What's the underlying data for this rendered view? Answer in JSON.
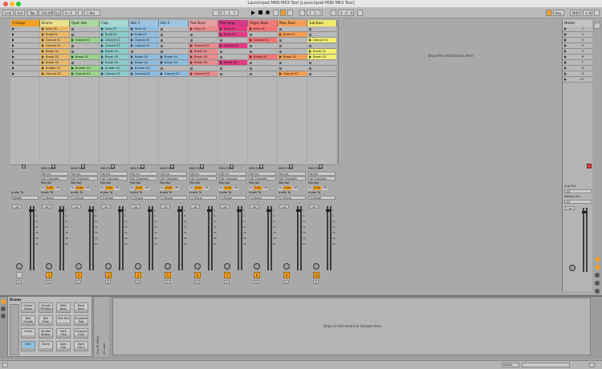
{
  "window": {
    "title": "Launchpad MINI MK3 Test  [Launchpad MINI MK3 Test]"
  },
  "controlbar": {
    "link": "Link",
    "ext": "Ext",
    "tap": "Tap",
    "tempo": "120.00",
    "sig": "4 / 4",
    "quant": "1 Bar",
    "pos1": "1 .  1 .  1",
    "pos2": "1 .  1 .  1",
    "len": "4 .  0 .  0",
    "key": "Key",
    "midi": "MIDI",
    "cpu": "3 %"
  },
  "colors": {
    "pink": "#f07ab8",
    "pinkdark": "#d2387e",
    "orange": "#f4a85d",
    "yellow": "#f2ee6e",
    "green": "#8cd48a",
    "lightgreen": "#b2e29c",
    "olive": "#d9c66b",
    "blue": "#93c0dd",
    "teal": "#75c6c2",
    "grey": "#b9b9b9"
  },
  "tracks": [
    {
      "name": "1 Group",
      "color": "#f2a124",
      "clips": [
        "",
        "",
        "",
        "",
        "",
        "",
        "",
        "",
        ""
      ]
    },
    {
      "name": "Drums",
      "color": "#e9e18c",
      "clips": [
        "Intro 01",
        "Build 01",
        "Groove 01",
        "Groove 02",
        "Break 01",
        "Break 03",
        "Break 04",
        "Builder 01",
        "Groove 03"
      ]
    },
    {
      "name": "Open Hat",
      "color": "#a9d99f",
      "clips": [
        "",
        "",
        "Groove 01",
        "",
        "",
        "Break 03",
        "",
        "Builder 01",
        "Groove 03"
      ]
    },
    {
      "name": "Clap",
      "color": "#a6d7d2",
      "clips": [
        "Intro 01",
        "Build 01",
        "Groove 01",
        "Groove 02",
        "Break 01",
        "Break 03",
        "Break 04",
        "Builder 01",
        "Groove 03"
      ]
    },
    {
      "name": "Bell 1",
      "color": "#9dc5e3",
      "clips": [
        "Intro 01",
        "Build 01",
        "Groove 01",
        "Groove 02",
        "",
        "Break 03",
        "Break 04",
        "Builder 01",
        "Groove 03"
      ]
    },
    {
      "name": "Bell 2",
      "color": "#9dc5e3",
      "clips": [
        "",
        "",
        "",
        "",
        "",
        "Break 03",
        "Break 04",
        "",
        "Groove 03"
      ]
    },
    {
      "name": "Pad Short",
      "color": "#e69fa3",
      "clips": [
        "Intro 01",
        "",
        "",
        "Groove 02",
        "Break 01",
        "Break 03",
        "Break 04",
        "",
        "Groove 03"
      ]
    },
    {
      "name": "Pad Long",
      "color": "#d83b86",
      "clips": [
        "Intro 01",
        "Build 01",
        "",
        "Groove 02",
        "",
        "",
        "Break 04",
        "",
        ""
      ]
    },
    {
      "name": "Organ Bass",
      "color": "#f27a7a",
      "clips": [
        "Intro 01",
        "",
        "Groove 01",
        "",
        "",
        "Break 03",
        "",
        "",
        ""
      ]
    },
    {
      "name": "Main Bass",
      "color": "#f4a05a",
      "clips": [
        "",
        "Build 01",
        "",
        "",
        "",
        "Break 03",
        "",
        "",
        "Groove 03"
      ]
    },
    {
      "name": "Sub Bass",
      "color": "#eee86c",
      "clips": [
        "",
        "",
        "Groove 01",
        "",
        "Break 01",
        "Break 03",
        "",
        "",
        ""
      ]
    }
  ],
  "session": {
    "drop_text": "Drop Files and Devices Here"
  },
  "io": {
    "midi_from": "MIDI From",
    "all_ins": "All Ins",
    "all_channels": "All Channels",
    "monitor": "Monitor",
    "in": "In",
    "auto": "Auto",
    "off": "Off",
    "audio_to": "Audio To",
    "group": "1-Group",
    "master": "Master",
    "cue_out": "Cue Out",
    "cue_val": "1/2",
    "master_out": "Master Out",
    "master_val": "1/2"
  },
  "mixer": {
    "vol_label": "-inf",
    "tick_labels": [
      "0",
      "6",
      "12",
      "24",
      "36",
      "48",
      "60"
    ],
    "master_name": "Master",
    "solo": "S",
    "master_numbers": [
      "1",
      "2",
      "3",
      "4",
      "5",
      "6",
      "7",
      "8",
      "9",
      "10"
    ],
    "track_numbers": [
      "1",
      "2",
      "3",
      "4",
      "5",
      "6",
      "7",
      "8",
      "9",
      "10",
      "11"
    ]
  },
  "drumrack": {
    "title": "Drums",
    "pads": [
      "Classic Organ",
      "Simple FM Bass",
      "Main Bass",
      "Rave Bass",
      "Bell Chords",
      "Bell Flash",
      "80s Pad",
      "Smoothe Pad",
      "Crash",
      "Shuffle Shaker",
      "Verb Clap",
      "Chopper Ride",
      "Kick",
      "Snare",
      "Open Hat",
      "Open Hat 2"
    ],
    "chain_labels": [
      "Kick 85 Whell",
      "Kit Light"
    ],
    "drop_text": "Drop an Instrument or Sample Here"
  },
  "statusbar": {
    "right": "Drums"
  }
}
